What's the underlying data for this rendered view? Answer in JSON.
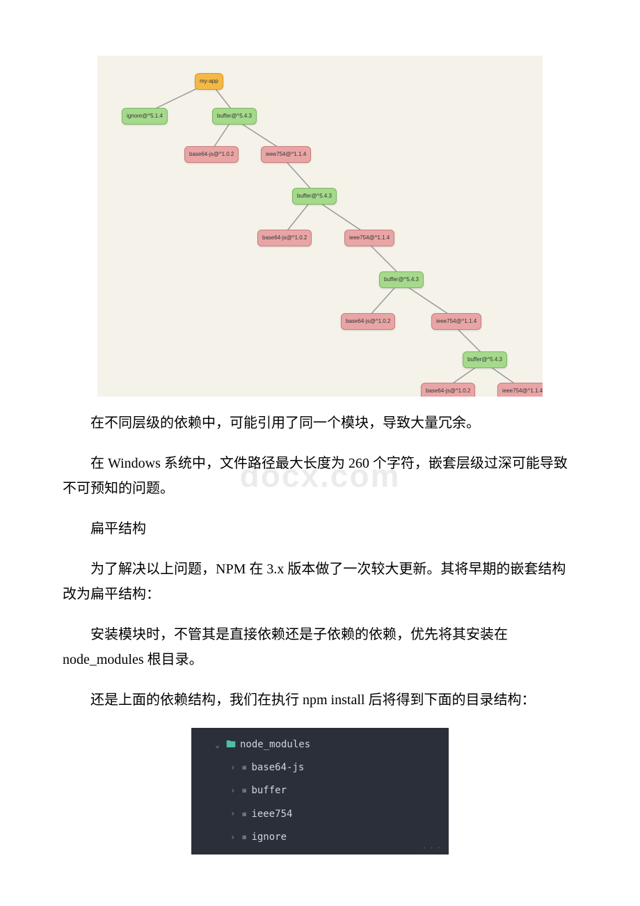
{
  "watermark": "docx.com",
  "tree": {
    "root": "my-app",
    "nodes": {
      "n1": "ignore@^5.1.4",
      "n2": "buffer@^5.4.3",
      "n3": "base64-js@^1.0.2",
      "n4": "ieee754@^1.1.4",
      "n5": "buffer@^5.4.3",
      "n6": "base64-js@^1.0.2",
      "n7": "ieee754@^1.1.4",
      "n8": "buffer@^5.4.3",
      "n9": "base64-js@^1.0.2",
      "n10": "ieee754@^1.1.4",
      "n11": "buffer@^5.4.3",
      "n12": "base64-js@^1.0.2",
      "n13": "ieee754@^1.1.4"
    }
  },
  "paragraphs": {
    "p1": "在不同层级的依赖中，可能引用了同一个模块，导致大量冗余。",
    "p2": "在 Windows 系统中，文件路径最大长度为 260 个字符，嵌套层级过深可能导致不可预知的问题。",
    "p3": "扁平结构",
    "p4": "为了解决以上问题，NPM 在 3.x 版本做了一次较大更新。其将早期的嵌套结构改为扁平结构：",
    "p5": "安装模块时，不管其是直接依赖还是子依赖的依赖，优先将其安装在 node_modules 根目录。",
    "p6": "还是上面的依赖结构，我们在执行 npm install 后将得到下面的目录结构："
  },
  "fileTree": {
    "root": "node_modules",
    "items": [
      "base64-js",
      "buffer",
      "ieee754",
      "ignore"
    ]
  }
}
